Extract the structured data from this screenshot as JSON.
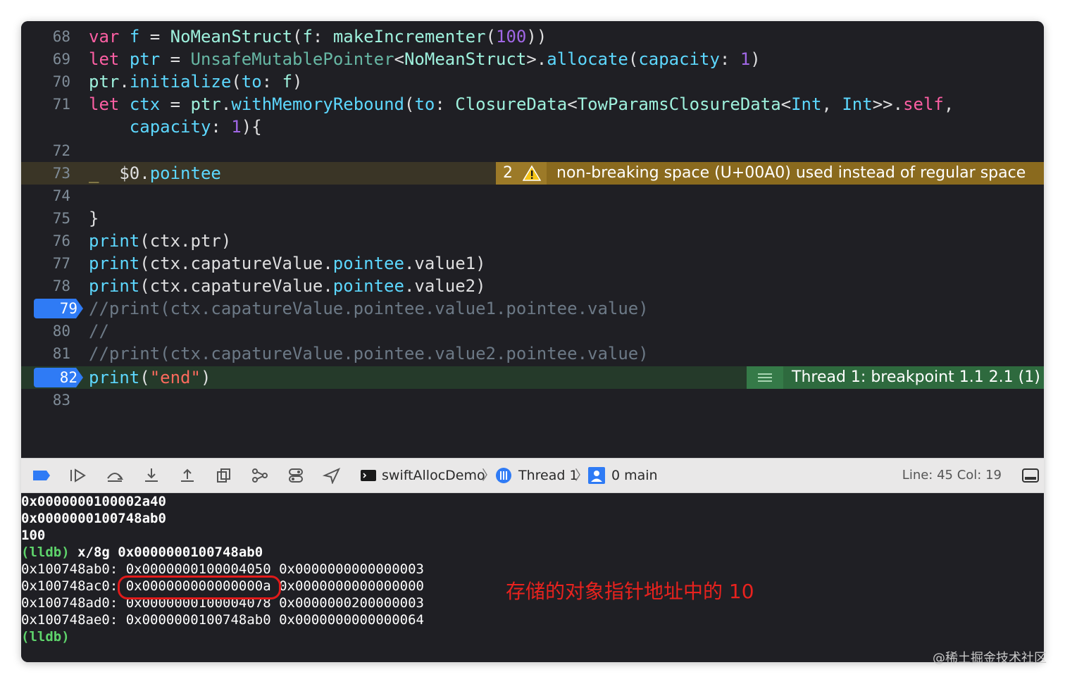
{
  "editor": {
    "lines": [
      {
        "num": "68",
        "segs": [
          {
            "c": "kw",
            "t": "var"
          },
          {
            "c": "pnt",
            "t": " "
          },
          {
            "c": "prop",
            "t": "f"
          },
          {
            "c": "pnt",
            "t": " = "
          },
          {
            "c": "ty",
            "t": "NoMeanStruct"
          },
          {
            "c": "pnt",
            "t": "("
          },
          {
            "c": "ty",
            "t": "f"
          },
          {
            "c": "pnt",
            "t": ": "
          },
          {
            "c": "ty",
            "t": "makeIncrementer"
          },
          {
            "c": "pnt",
            "t": "("
          },
          {
            "c": "lbl",
            "t": "100"
          },
          {
            "c": "pnt",
            "t": "))"
          }
        ]
      },
      {
        "num": "69",
        "segs": [
          {
            "c": "kw",
            "t": "let"
          },
          {
            "c": "pnt",
            "t": " "
          },
          {
            "c": "prop",
            "t": "ptr"
          },
          {
            "c": "pnt",
            "t": " = "
          },
          {
            "c": "fn",
            "t": "UnsafeMutablePointer"
          },
          {
            "c": "pnt",
            "t": "<"
          },
          {
            "c": "ty",
            "t": "NoMeanStruct"
          },
          {
            "c": "pnt",
            "t": ">."
          },
          {
            "c": "prop",
            "t": "allocate"
          },
          {
            "c": "pnt",
            "t": "("
          },
          {
            "c": "prop",
            "t": "capacity"
          },
          {
            "c": "pnt",
            "t": ": "
          },
          {
            "c": "lbl",
            "t": "1"
          },
          {
            "c": "pnt",
            "t": ")"
          }
        ]
      },
      {
        "num": "70",
        "segs": [
          {
            "c": "ty",
            "t": "ptr"
          },
          {
            "c": "pnt",
            "t": "."
          },
          {
            "c": "prop",
            "t": "initialize"
          },
          {
            "c": "pnt",
            "t": "("
          },
          {
            "c": "prop",
            "t": "to"
          },
          {
            "c": "pnt",
            "t": ": "
          },
          {
            "c": "ty",
            "t": "f"
          },
          {
            "c": "pnt",
            "t": ")"
          }
        ]
      },
      {
        "num": "71",
        "segs": [
          {
            "c": "kw",
            "t": "let"
          },
          {
            "c": "pnt",
            "t": " "
          },
          {
            "c": "prop",
            "t": "ctx"
          },
          {
            "c": "pnt",
            "t": " = "
          },
          {
            "c": "ty",
            "t": "ptr"
          },
          {
            "c": "pnt",
            "t": "."
          },
          {
            "c": "prop",
            "t": "withMemoryRebound"
          },
          {
            "c": "pnt",
            "t": "("
          },
          {
            "c": "prop",
            "t": "to"
          },
          {
            "c": "pnt",
            "t": ": "
          },
          {
            "c": "ty",
            "t": "ClosureData"
          },
          {
            "c": "pnt",
            "t": "<"
          },
          {
            "c": "ty",
            "t": "TowParamsClosureData"
          },
          {
            "c": "pnt",
            "t": "<"
          },
          {
            "c": "prop",
            "t": "Int"
          },
          {
            "c": "pnt",
            "t": ", "
          },
          {
            "c": "prop",
            "t": "Int"
          },
          {
            "c": "pnt",
            "t": ">>."
          },
          {
            "c": "kw",
            "t": "self"
          },
          {
            "c": "pnt",
            "t": ","
          }
        ]
      },
      {
        "num": "",
        "segs": [
          {
            "c": "pnt",
            "t": "    "
          },
          {
            "c": "prop",
            "t": "capacity"
          },
          {
            "c": "pnt",
            "t": ": "
          },
          {
            "c": "lbl",
            "t": "1"
          },
          {
            "c": "pnt",
            "t": "){"
          }
        ]
      },
      {
        "num": "72",
        "segs": []
      },
      {
        "num": "73",
        "segs": [
          {
            "c": "num-c",
            "t": "_"
          },
          {
            "c": "pnt",
            "t": "  $0."
          },
          {
            "c": "prop",
            "t": "pointee"
          }
        ]
      },
      {
        "num": "74",
        "segs": []
      },
      {
        "num": "75",
        "segs": [
          {
            "c": "pnt",
            "t": "}"
          }
        ]
      },
      {
        "num": "76",
        "segs": [
          {
            "c": "prop",
            "t": "print"
          },
          {
            "c": "pnt",
            "t": "(ctx.ptr)"
          }
        ]
      },
      {
        "num": "77",
        "segs": [
          {
            "c": "prop",
            "t": "print"
          },
          {
            "c": "pnt",
            "t": "(ctx.capatureValue."
          },
          {
            "c": "prop",
            "t": "pointee"
          },
          {
            "c": "pnt",
            "t": ".value1)"
          }
        ]
      },
      {
        "num": "78",
        "segs": [
          {
            "c": "prop",
            "t": "print"
          },
          {
            "c": "pnt",
            "t": "(ctx.capatureValue."
          },
          {
            "c": "prop",
            "t": "pointee"
          },
          {
            "c": "pnt",
            "t": ".value2)"
          }
        ]
      },
      {
        "num": "79",
        "segs": [
          {
            "c": "cmt",
            "t": "//print(ctx.capatureValue.pointee.value1.pointee.value)"
          }
        ]
      },
      {
        "num": "80",
        "segs": [
          {
            "c": "cmt",
            "t": "//"
          }
        ]
      },
      {
        "num": "81",
        "segs": [
          {
            "c": "cmt",
            "t": "//print(ctx.capatureValue.pointee.value2.pointee.value)"
          }
        ]
      },
      {
        "num": "82",
        "segs": [
          {
            "c": "prop",
            "t": "print"
          },
          {
            "c": "pnt",
            "t": "("
          },
          {
            "c": "str",
            "t": "\"end\""
          },
          {
            "c": "pnt",
            "t": ")"
          }
        ]
      },
      {
        "num": "83",
        "segs": []
      }
    ],
    "warning": {
      "count": "2",
      "message": "non-breaking space (U+00A0) used instead of regular space"
    },
    "breakpoint_msg": "Thread 1: breakpoint 1.1 2.1 (1)"
  },
  "toolbar": {
    "target": "swiftAllocDemo",
    "thread": "Thread 1",
    "frame": "0 main",
    "position": "Line: 45  Col: 19"
  },
  "console": {
    "lines": [
      "0x0000000100002a40",
      "0x0000000100748ab0",
      "100"
    ],
    "lldb_prompt": "(lldb)",
    "lldb_cmd": " x/8g 0x0000000100748ab0",
    "mem": [
      {
        "addr": "0x100748ab0:",
        "v1": "0x0000000100004050",
        "v2": "0x0000000000000003"
      },
      {
        "addr": "0x100748ac0:",
        "v1": "0x000000000000000a",
        "v2": "0x0000000000000000"
      },
      {
        "addr": "0x100748ad0:",
        "v1": "0x0000000100004078",
        "v2": "0x0000000200000003"
      },
      {
        "addr": "0x100748ae0:",
        "v1": "0x0000000100748ab0",
        "v2": "0x0000000000000064"
      }
    ],
    "final_prompt": "(lldb)",
    "annotation": "存储的对象指针地址中的 10"
  },
  "watermark": "@稀土掘金技术社区"
}
